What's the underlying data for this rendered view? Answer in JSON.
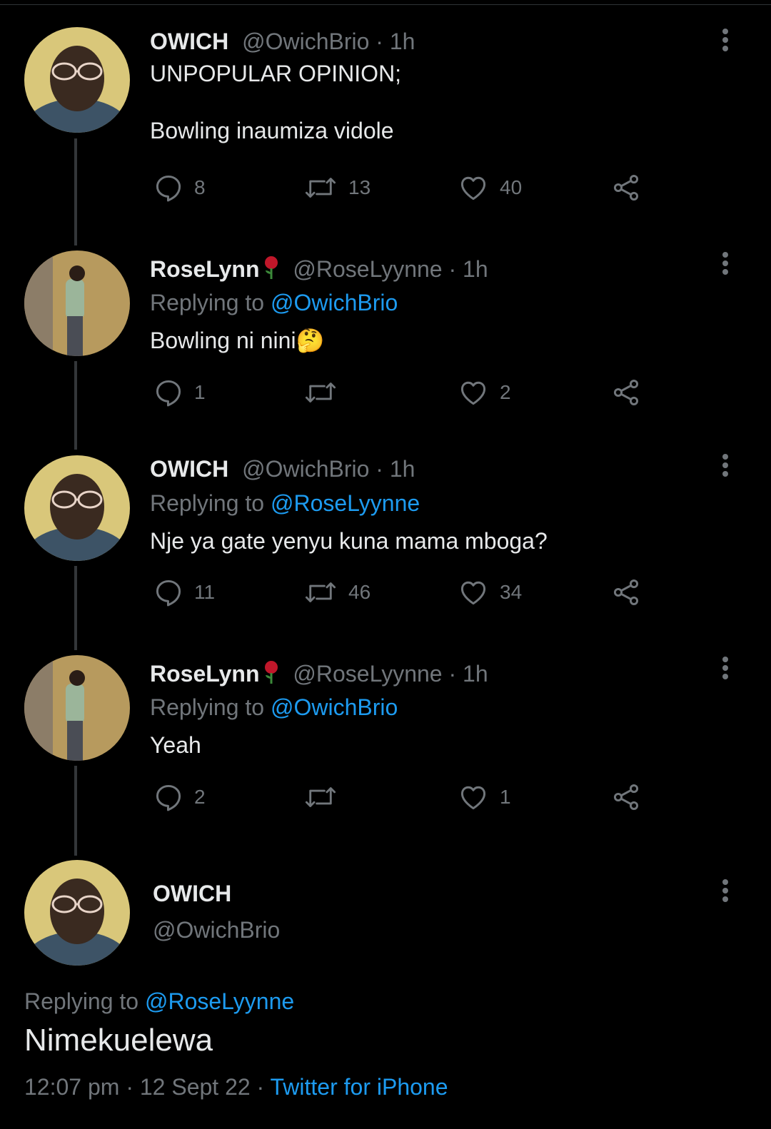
{
  "tweets": [
    {
      "name": "OWICH",
      "handle": "@OwichBrio",
      "time": "1h",
      "replying_prefix": "",
      "replying_to": "",
      "text": "UNPOPULAR OPINION;\n\nBowling inaumiza vidole",
      "avatar": "owich",
      "has_rose": false,
      "replies": "8",
      "retweets": "13",
      "likes": "40"
    },
    {
      "name": "RoseLynn",
      "handle": "@RoseLyynne",
      "time": "1h",
      "replying_prefix": "Replying to",
      "replying_to": "@OwichBrio",
      "text": "Bowling ni nini🤔",
      "avatar": "roselynn",
      "has_rose": true,
      "replies": "1",
      "retweets": "",
      "likes": "2"
    },
    {
      "name": "OWICH",
      "handle": "@OwichBrio",
      "time": "1h",
      "replying_prefix": "Replying to",
      "replying_to": "@RoseLyynne",
      "text": "Nje ya gate yenyu kuna mama mboga?",
      "avatar": "owich",
      "has_rose": false,
      "replies": "11",
      "retweets": "46",
      "likes": "34"
    },
    {
      "name": "RoseLynn",
      "handle": "@RoseLyynne",
      "time": "1h",
      "replying_prefix": "Replying to",
      "replying_to": "@OwichBrio",
      "text": "Yeah",
      "avatar": "roselynn",
      "has_rose": true,
      "replies": "2",
      "retweets": "",
      "likes": "1"
    }
  ],
  "main_tweet": {
    "name": "OWICH",
    "handle": "@OwichBrio",
    "replying_prefix": "Replying to",
    "replying_to": "@RoseLyynne",
    "text": "Nimekuelewa",
    "time": "12:07 pm",
    "date": "12 Sept 22",
    "source": "Twitter for iPhone"
  },
  "separator": "·",
  "colors": {
    "background": "#000000",
    "text": "#e7e9ea",
    "muted": "#71767b",
    "link": "#1d9bf0",
    "thread_line": "#333639"
  },
  "icons": {
    "reply": "reply-icon",
    "retweet": "retweet-icon",
    "like": "heart-icon",
    "share": "share-icon",
    "more": "more-vertical-icon",
    "rose": "rose-emoji-icon"
  }
}
